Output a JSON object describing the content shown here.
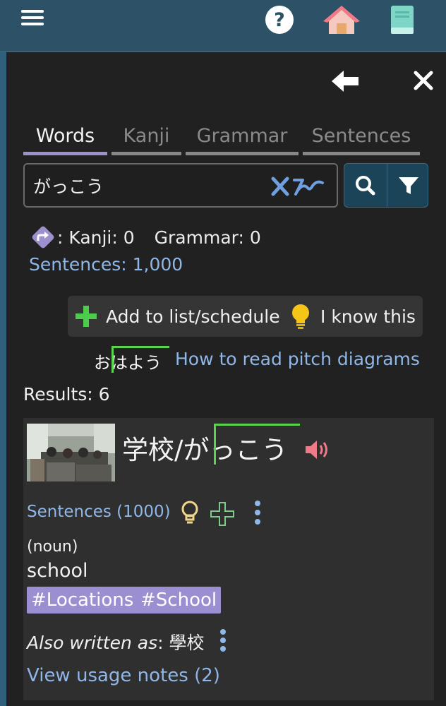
{
  "topbar": {
    "menu_icon": "hamburger-menu-icon",
    "help_icon": "question-circle-icon",
    "home_icon": "home-icon",
    "book_icon": "book-icon"
  },
  "panel": {
    "back_icon": "arrow-left-icon",
    "close_icon": "close-icon"
  },
  "tabs": [
    {
      "label": "Words",
      "active": true
    },
    {
      "label": "Kanji",
      "active": false
    },
    {
      "label": "Grammar",
      "active": false
    },
    {
      "label": "Sentences",
      "active": false
    }
  ],
  "search": {
    "value": "がっこう",
    "clear_icon": "clear-ime-icon",
    "search_icon": "search-icon",
    "filter_icon": "filter-icon"
  },
  "stats": {
    "kanji": ": Kanji: 0",
    "grammar": "Grammar: 0",
    "sentences": "Sentences: 1,000"
  },
  "actions": {
    "add_label": "Add to list/schedule",
    "know_label": "I know this"
  },
  "pitch": {
    "demo": "おはよう",
    "link": "How to read pitch diagrams"
  },
  "results_label": "Results: 6",
  "entry": {
    "title": "学校/がっこう",
    "sentences_link": "Sentences (1000)",
    "pos": "(noun)",
    "meaning": "school",
    "tags": [
      "#Locations",
      "#School"
    ],
    "also_label": "Also written as",
    "also_value": ": 學校",
    "usage_link": "View usage notes (2)"
  },
  "colors": {
    "topbar": "#2d5166",
    "panel": "#212121",
    "card": "#2f2f2f",
    "accent_purple": "#9e8fcf",
    "link_blue": "#8fb7e8",
    "pitch_green": "#5bd44b",
    "add_green": "#4ccb4c",
    "bulb_yellow": "#f5c518",
    "audio_pink": "#f07a88"
  }
}
